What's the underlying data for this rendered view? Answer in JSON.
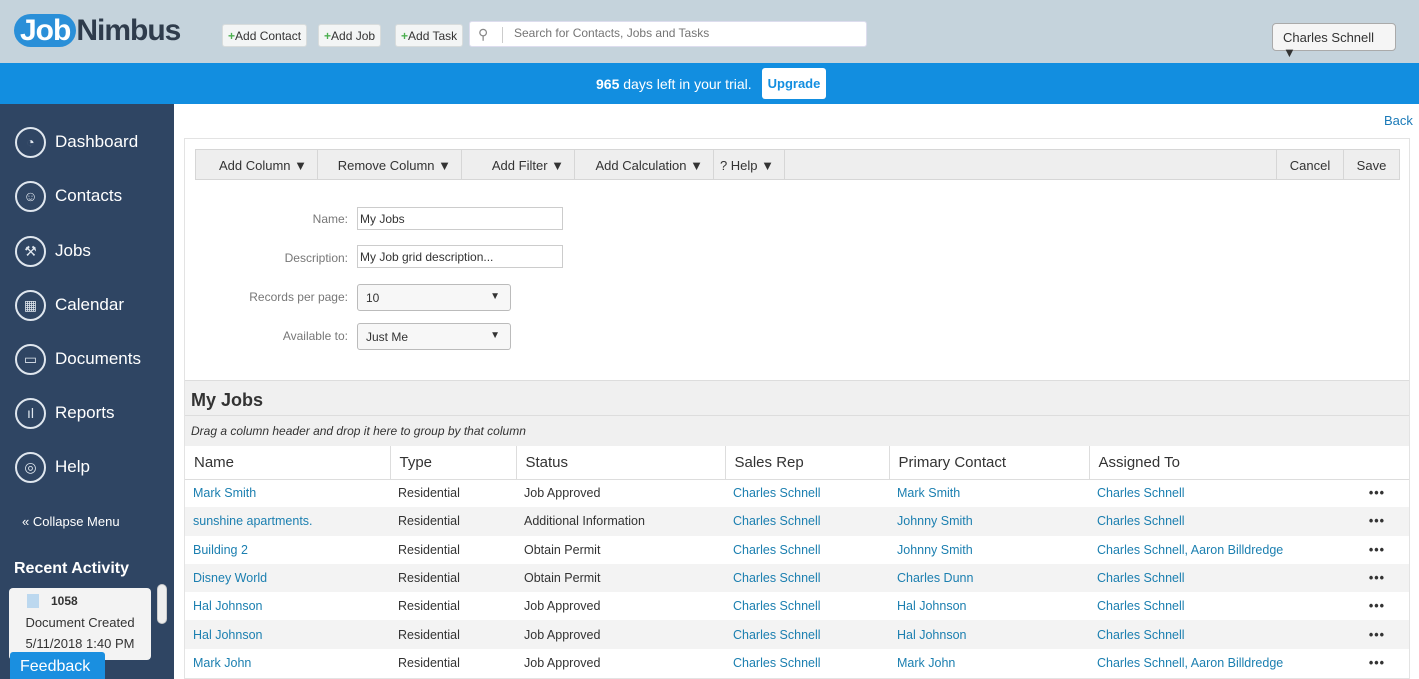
{
  "header": {
    "logo_a": "Job",
    "logo_b": "Nimbus",
    "add_contact": "Add Contact",
    "add_job": "Add Job",
    "add_task": "Add Task",
    "search_placeholder": "Search for Contacts, Jobs and Tasks",
    "user": "Charles Schnell ▼"
  },
  "trial": {
    "days": "965",
    "text": " days left in your trial.",
    "upgrade": "Upgrade"
  },
  "sidebar": {
    "items": [
      {
        "label": "Dashboard",
        "icon": "◔"
      },
      {
        "label": "Contacts",
        "icon": "☺"
      },
      {
        "label": "Jobs",
        "icon": "⚒"
      },
      {
        "label": "Calendar",
        "icon": "▦"
      },
      {
        "label": "Documents",
        "icon": "▭"
      },
      {
        "label": "Reports",
        "icon": "ıl"
      },
      {
        "label": "Help",
        "icon": "◎"
      }
    ],
    "collapse": "«  Collapse Menu",
    "recent_title": "Recent Activity",
    "activity": {
      "number": "1058",
      "title": "Document Created",
      "time": "5/11/2018 1:40 PM"
    },
    "feedback": "Feedback"
  },
  "back": "Back",
  "toolbar": {
    "add_column": "Add Column ▼",
    "remove_column": "Remove Column ▼",
    "add_filter": "Add Filter  ▼",
    "add_calculation": "Add Calculation ▼",
    "help": "? Help ▼",
    "cancel": "Cancel",
    "save": "Save"
  },
  "form": {
    "name_label": "Name:",
    "name_value": "My Jobs",
    "desc_label": "Description:",
    "desc_value": "My Job grid description...",
    "records_label": "Records per page:",
    "records_value": "10",
    "avail_label": "Available to:",
    "avail_value": "Just Me"
  },
  "grid": {
    "title": "My Jobs",
    "group_hint": "Drag a column header and drop it here to group by that column",
    "columns": [
      "Name",
      "Type",
      "Status",
      "Sales Rep",
      "Primary Contact",
      "Assigned To"
    ],
    "rows": [
      [
        "Mark Smith",
        "Residential",
        "Job Approved",
        "Charles Schnell",
        "Mark Smith",
        "Charles Schnell"
      ],
      [
        "sunshine apartments.",
        "Residential",
        "Additional Information",
        "Charles Schnell",
        "Johnny Smith",
        "Charles Schnell"
      ],
      [
        "Building 2",
        "Residential",
        "Obtain Permit",
        "Charles Schnell",
        "Johnny Smith",
        "Charles Schnell, Aaron Billdredge"
      ],
      [
        "Disney World",
        "Residential",
        "Obtain Permit",
        "Charles Schnell",
        "Charles Dunn",
        "Charles Schnell"
      ],
      [
        "Hal Johnson",
        "Residential",
        "Job Approved",
        "Charles Schnell",
        "Hal Johnson",
        "Charles Schnell"
      ],
      [
        "Hal Johnson",
        "Residential",
        "Job Approved",
        "Charles Schnell",
        "Hal Johnson",
        "Charles Schnell"
      ],
      [
        "Mark John",
        "Residential",
        "Job Approved",
        "Charles Schnell",
        "Mark John",
        "Charles Schnell, Aaron Billdredge"
      ]
    ],
    "more": "•••"
  }
}
